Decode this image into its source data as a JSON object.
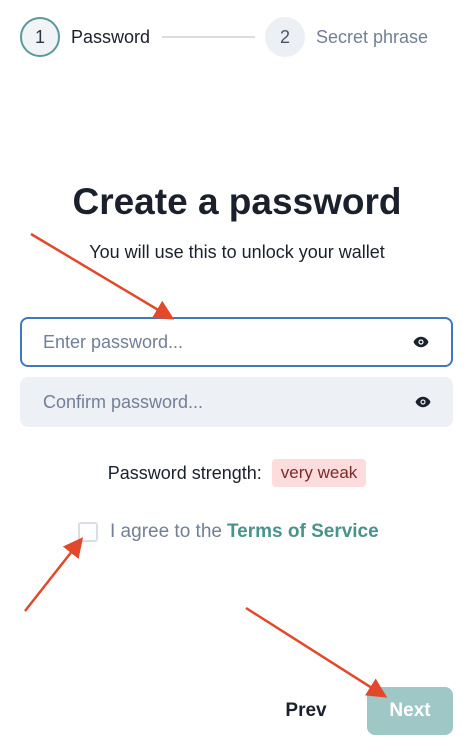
{
  "stepper": {
    "steps": [
      {
        "number": "1",
        "label": "Password"
      },
      {
        "number": "2",
        "label": "Secret phrase"
      }
    ]
  },
  "main": {
    "title": "Create a password",
    "subtitle": "You will use this to unlock your wallet"
  },
  "form": {
    "password_placeholder": "Enter password...",
    "confirm_placeholder": "Confirm password...",
    "password_value": "",
    "confirm_value": "",
    "visibility_icon": "eye-icon"
  },
  "strength": {
    "label": "Password strength:",
    "value": "very weak"
  },
  "terms": {
    "text": "I agree to the",
    "link": "Terms of Service",
    "checked": false
  },
  "footer": {
    "prev_label": "Prev",
    "next_label": "Next"
  },
  "colors": {
    "accent": "#4a928d",
    "annotation_arrow": "#e2492b",
    "input_focus_border": "#3e78c2",
    "next_button_disabled": "#9ec7c6",
    "weak_badge_bg": "#fcdcdc"
  }
}
